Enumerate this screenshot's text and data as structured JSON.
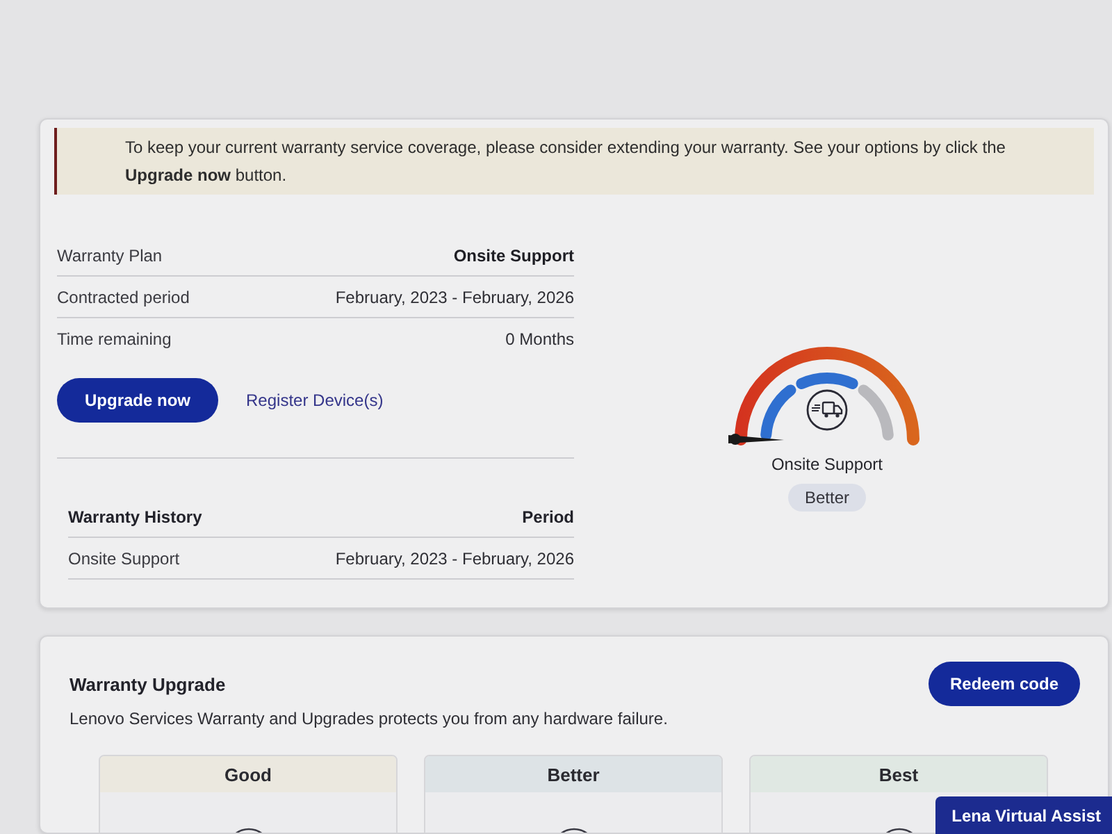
{
  "notice": {
    "text": "To keep your current warranty service coverage, please consider extending your warranty. See your options by click the **Upgrade now** button."
  },
  "warranty": {
    "rows": [
      {
        "kind": "plan",
        "label": "Warranty Plan",
        "value": "Onsite Support"
      },
      {
        "kind": "detail",
        "label": "Contracted period",
        "value": "February, 2023 - February, 2026"
      },
      {
        "kind": "detail",
        "label": "Time remaining",
        "value": "0 Months"
      }
    ]
  },
  "actions": {
    "primary": "Upgrade now",
    "link": "Register Device(s)"
  },
  "history": {
    "columns": [
      "Warranty History",
      "Period"
    ],
    "rows": [
      {
        "plan": "Onsite Support",
        "period": "February, 2023 - February, 2026"
      }
    ]
  },
  "gauge": {
    "segments": [
      {
        "on": true
      },
      {
        "on": true
      },
      {
        "on": false
      }
    ],
    "label": "Onsite Support",
    "badge": "Better"
  },
  "upgrade": {
    "title": "Warranty Upgrade",
    "button": "Redeem code",
    "description": "Lenovo Services Warranty and Upgrades protects you from any hardware failure.",
    "tiers": [
      {
        "label": "Good",
        "color": "#ebe8df"
      },
      {
        "label": "Better",
        "color": "#dde3e6"
      },
      {
        "label": "Best",
        "color": "#e0e8e3"
      }
    ]
  },
  "assistant": {
    "label": "Lena Virtual Assist"
  }
}
